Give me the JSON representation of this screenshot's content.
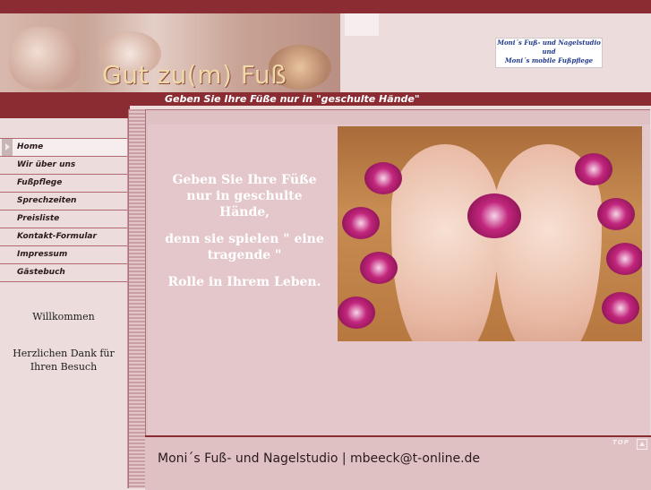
{
  "header": {
    "banner_title": "Gut zu(m) Fuß",
    "logo_line1": "Moni´s Fuß- und Nagelstudio",
    "logo_line2": "und",
    "logo_line3": "Moni´s mobile Fußpflege",
    "tagline": "Geben Sie Ihre Füße nur in \"geschulte Hände\""
  },
  "nav": {
    "items": [
      {
        "label": "Home"
      },
      {
        "label": "Wir über uns"
      },
      {
        "label": "Fußpflege"
      },
      {
        "label": "Sprechzeiten"
      },
      {
        "label": "Preisliste"
      },
      {
        "label": "Kontakt-Formular"
      },
      {
        "label": "Impressum"
      },
      {
        "label": "Gästebuch"
      }
    ]
  },
  "sidebar": {
    "welcome": "Willkommen",
    "thanks": "Herzlichen Dank für Ihren Besuch"
  },
  "main": {
    "poem_line1": "Geben Sie Ihre Füße nur in geschulte Hände,",
    "poem_line2": "denn sie spielen \" eine tragende \"",
    "poem_line3": "Rolle in Ihrem Leben."
  },
  "footer": {
    "text": "Moni´s Fuß- und Nagelstudio | mbeeck@t-online.de",
    "top_label": "TOP"
  },
  "colors": {
    "accent": "#8b2c33",
    "background": "#ecdcdc",
    "content": "#e4c7ca"
  }
}
